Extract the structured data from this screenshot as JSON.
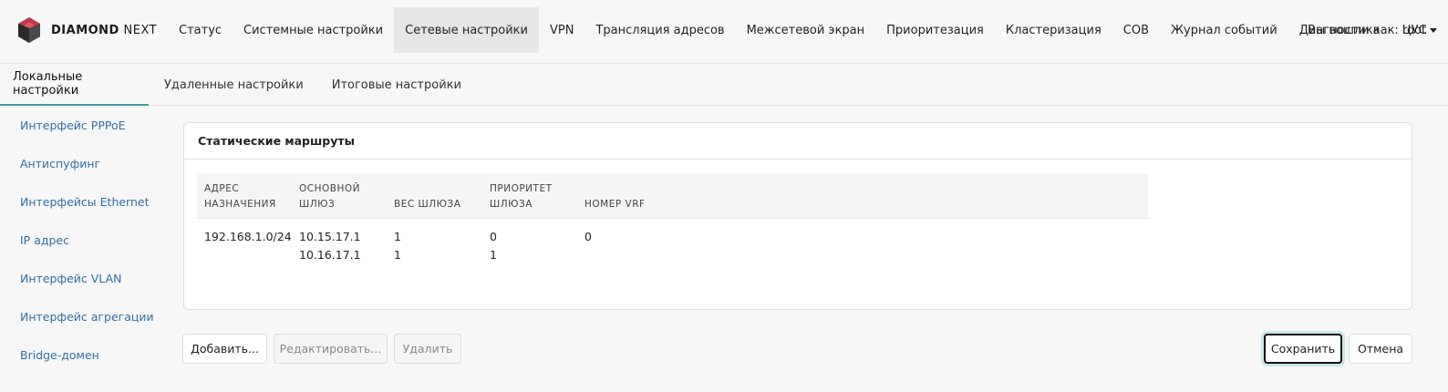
{
  "brand": {
    "name_bold": "DIAMOND",
    "name_light": "NEXT"
  },
  "nav": {
    "items": [
      {
        "label": "Статус"
      },
      {
        "label": "Системные настройки"
      },
      {
        "label": "Сетевые настройки",
        "active": true
      },
      {
        "label": "VPN"
      },
      {
        "label": "Трансляция адресов"
      },
      {
        "label": "Межсетевой экран"
      },
      {
        "label": "Приоритезация"
      },
      {
        "label": "Кластеризация"
      },
      {
        "label": "СОВ"
      },
      {
        "label": "Журнал событий"
      },
      {
        "label": "Диагностика"
      },
      {
        "label": "ЦУС"
      }
    ],
    "user": "Вы вошли как: root"
  },
  "subtabs": [
    {
      "label": "Локальные настройки",
      "active": true
    },
    {
      "label": "Удаленные настройки"
    },
    {
      "label": "Итоговые настройки"
    }
  ],
  "sidebar": {
    "items": [
      {
        "label": "Интерфейс PPPoE"
      },
      {
        "label": "Антиспуфинг"
      },
      {
        "label": "Интерфейсы Ethernet"
      },
      {
        "label": "IP адрес"
      },
      {
        "label": "Интерфейс VLAN"
      },
      {
        "label": "Интерфейс агрегации"
      },
      {
        "label": "Bridge-домен"
      }
    ]
  },
  "card": {
    "title": "Статические маршруты",
    "columns": [
      {
        "line1": "Адрес",
        "line2": "назначения"
      },
      {
        "line1": "Основной",
        "line2": "шлюз"
      },
      {
        "line1": "Вес шлюза",
        "line2": ""
      },
      {
        "line1": "Приоритет",
        "line2": "шлюза"
      },
      {
        "line1": "Номер VRF",
        "line2": ""
      }
    ],
    "rows": [
      {
        "destination": "192.168.1.0/24",
        "gateways": [
          "10.15.17.1",
          "10.16.17.1"
        ],
        "weights": [
          "1",
          "1"
        ],
        "priorities": [
          "0",
          "1"
        ],
        "vrf": "0"
      }
    ]
  },
  "buttons": {
    "add": "Добавить...",
    "edit": "Редактировать...",
    "delete": "Удалить",
    "save": "Сохранить",
    "cancel": "Отмена"
  },
  "colors": {
    "accent": "#3fa0a0",
    "link": "#2f6fa5",
    "active_nav_bg": "#e6e6e6"
  }
}
